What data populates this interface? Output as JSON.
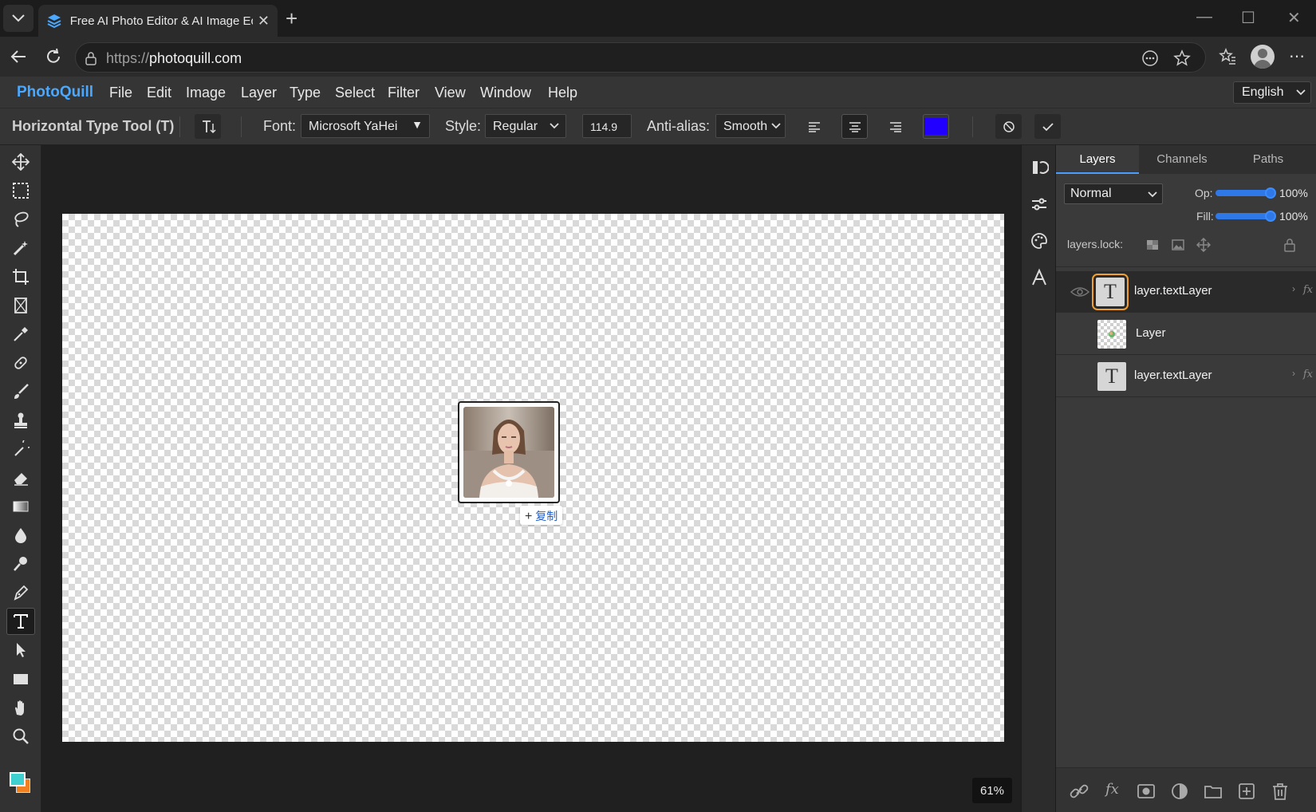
{
  "browser": {
    "tab_title": "Free AI Photo Editor & AI Image Ec",
    "url_prefix": "https://",
    "url_host": "photoquill.com"
  },
  "app": {
    "brand": "PhotoQuill",
    "menu": [
      "File",
      "Edit",
      "Image",
      "Layer",
      "Type",
      "Select",
      "Filter",
      "View",
      "Window",
      "Help"
    ],
    "language": "English"
  },
  "options": {
    "tool_name": "Horizontal Type Tool (T)",
    "font_label": "Font:",
    "font_value": "Microsoft YaHei",
    "style_label": "Style:",
    "style_value": "Regular",
    "size_value": "114.9",
    "antialias_label": "Anti-alias:",
    "antialias_value": "Smooth",
    "text_color": "#2200ff"
  },
  "canvas": {
    "copy_label": "复制",
    "zoom": "61%"
  },
  "panel": {
    "tabs": [
      "Layers",
      "Channels",
      "Paths"
    ],
    "blend_mode": "Normal",
    "opacity_label": "Op:",
    "opacity_value": "100%",
    "fill_label": "Fill:",
    "fill_value": "100%",
    "lock_label": "layers.lock:",
    "layers": [
      {
        "name": "layer.textLayer",
        "thumb": "T",
        "fx": "fx"
      },
      {
        "name": "Layer"
      },
      {
        "name": "layer.textLayer",
        "thumb": "T",
        "fx": "fx"
      }
    ]
  },
  "colors": {
    "accent": "#4aa8ff",
    "foreground_swatch": "#40d0d0",
    "background_swatch": "#f08020"
  }
}
